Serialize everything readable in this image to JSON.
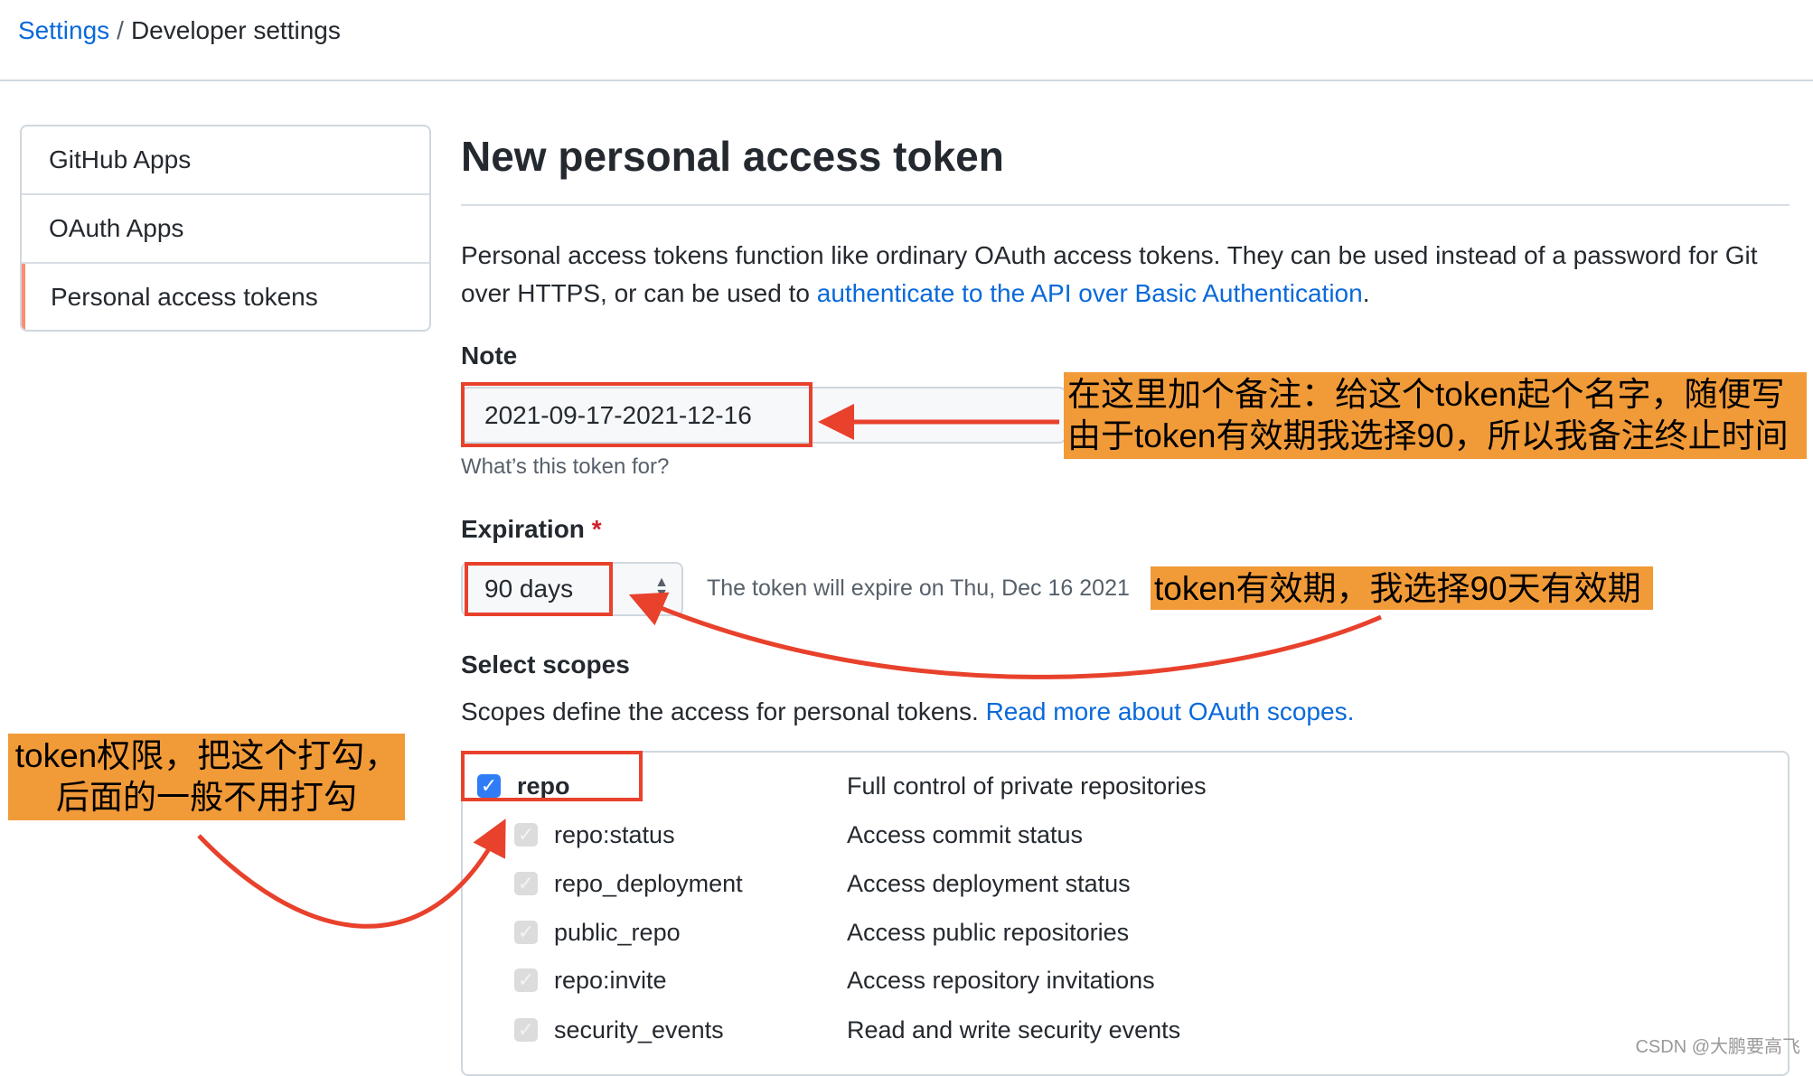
{
  "breadcrumb": {
    "settings": "Settings",
    "separator": "/",
    "current": "Developer settings"
  },
  "sidebar": {
    "items": [
      {
        "label": "GitHub Apps"
      },
      {
        "label": "OAuth Apps"
      },
      {
        "label": "Personal access tokens",
        "active": true
      }
    ]
  },
  "main": {
    "title": "New personal access token",
    "intro_text": "Personal access tokens function like ordinary OAuth access tokens. They can be used instead of a password for Git over HTTPS, or can be used to ",
    "intro_link": "authenticate to the API over Basic Authentication",
    "intro_end": ".",
    "note": {
      "label": "Note",
      "value": "2021-09-17-2021-12-16",
      "help": "What’s this token for?"
    },
    "expiration": {
      "label": "Expiration",
      "required": "*",
      "value": "90 days",
      "expire_text": "The token will expire on Thu, Dec 16 2021"
    },
    "scopes": {
      "label": "Select scopes",
      "desc": "Scopes define the access for personal tokens. ",
      "link": "Read more about OAuth scopes.",
      "rows": [
        {
          "name": "repo",
          "desc": "Full control of private repositories",
          "checked": true
        },
        {
          "name": "repo:status",
          "desc": "Access commit status",
          "checked": true
        },
        {
          "name": "repo_deployment",
          "desc": "Access deployment status",
          "checked": true
        },
        {
          "name": "public_repo",
          "desc": "Access public repositories",
          "checked": true
        },
        {
          "name": "repo:invite",
          "desc": "Access repository invitations",
          "checked": true
        },
        {
          "name": "security_events",
          "desc": "Read and write security events",
          "checked": true
        }
      ]
    }
  },
  "annotations": {
    "note_line1": "在这里加个备注：给这个token起个名字，随便写",
    "note_line2": "由于token有效期我选择90，所以我备注终止时间",
    "expiration": "token有效期，我选择90天有效期",
    "scope_line1": "token权限，把这个打勾，",
    "scope_line2": "后面的一般不用打勾"
  },
  "colors": {
    "link": "#0969da",
    "annotation_bg": "#f19a38",
    "highlight_red": "#e8412c",
    "checkbox_blue": "#2f7cf6"
  },
  "watermark": "CSDN @大鹏要高飞"
}
